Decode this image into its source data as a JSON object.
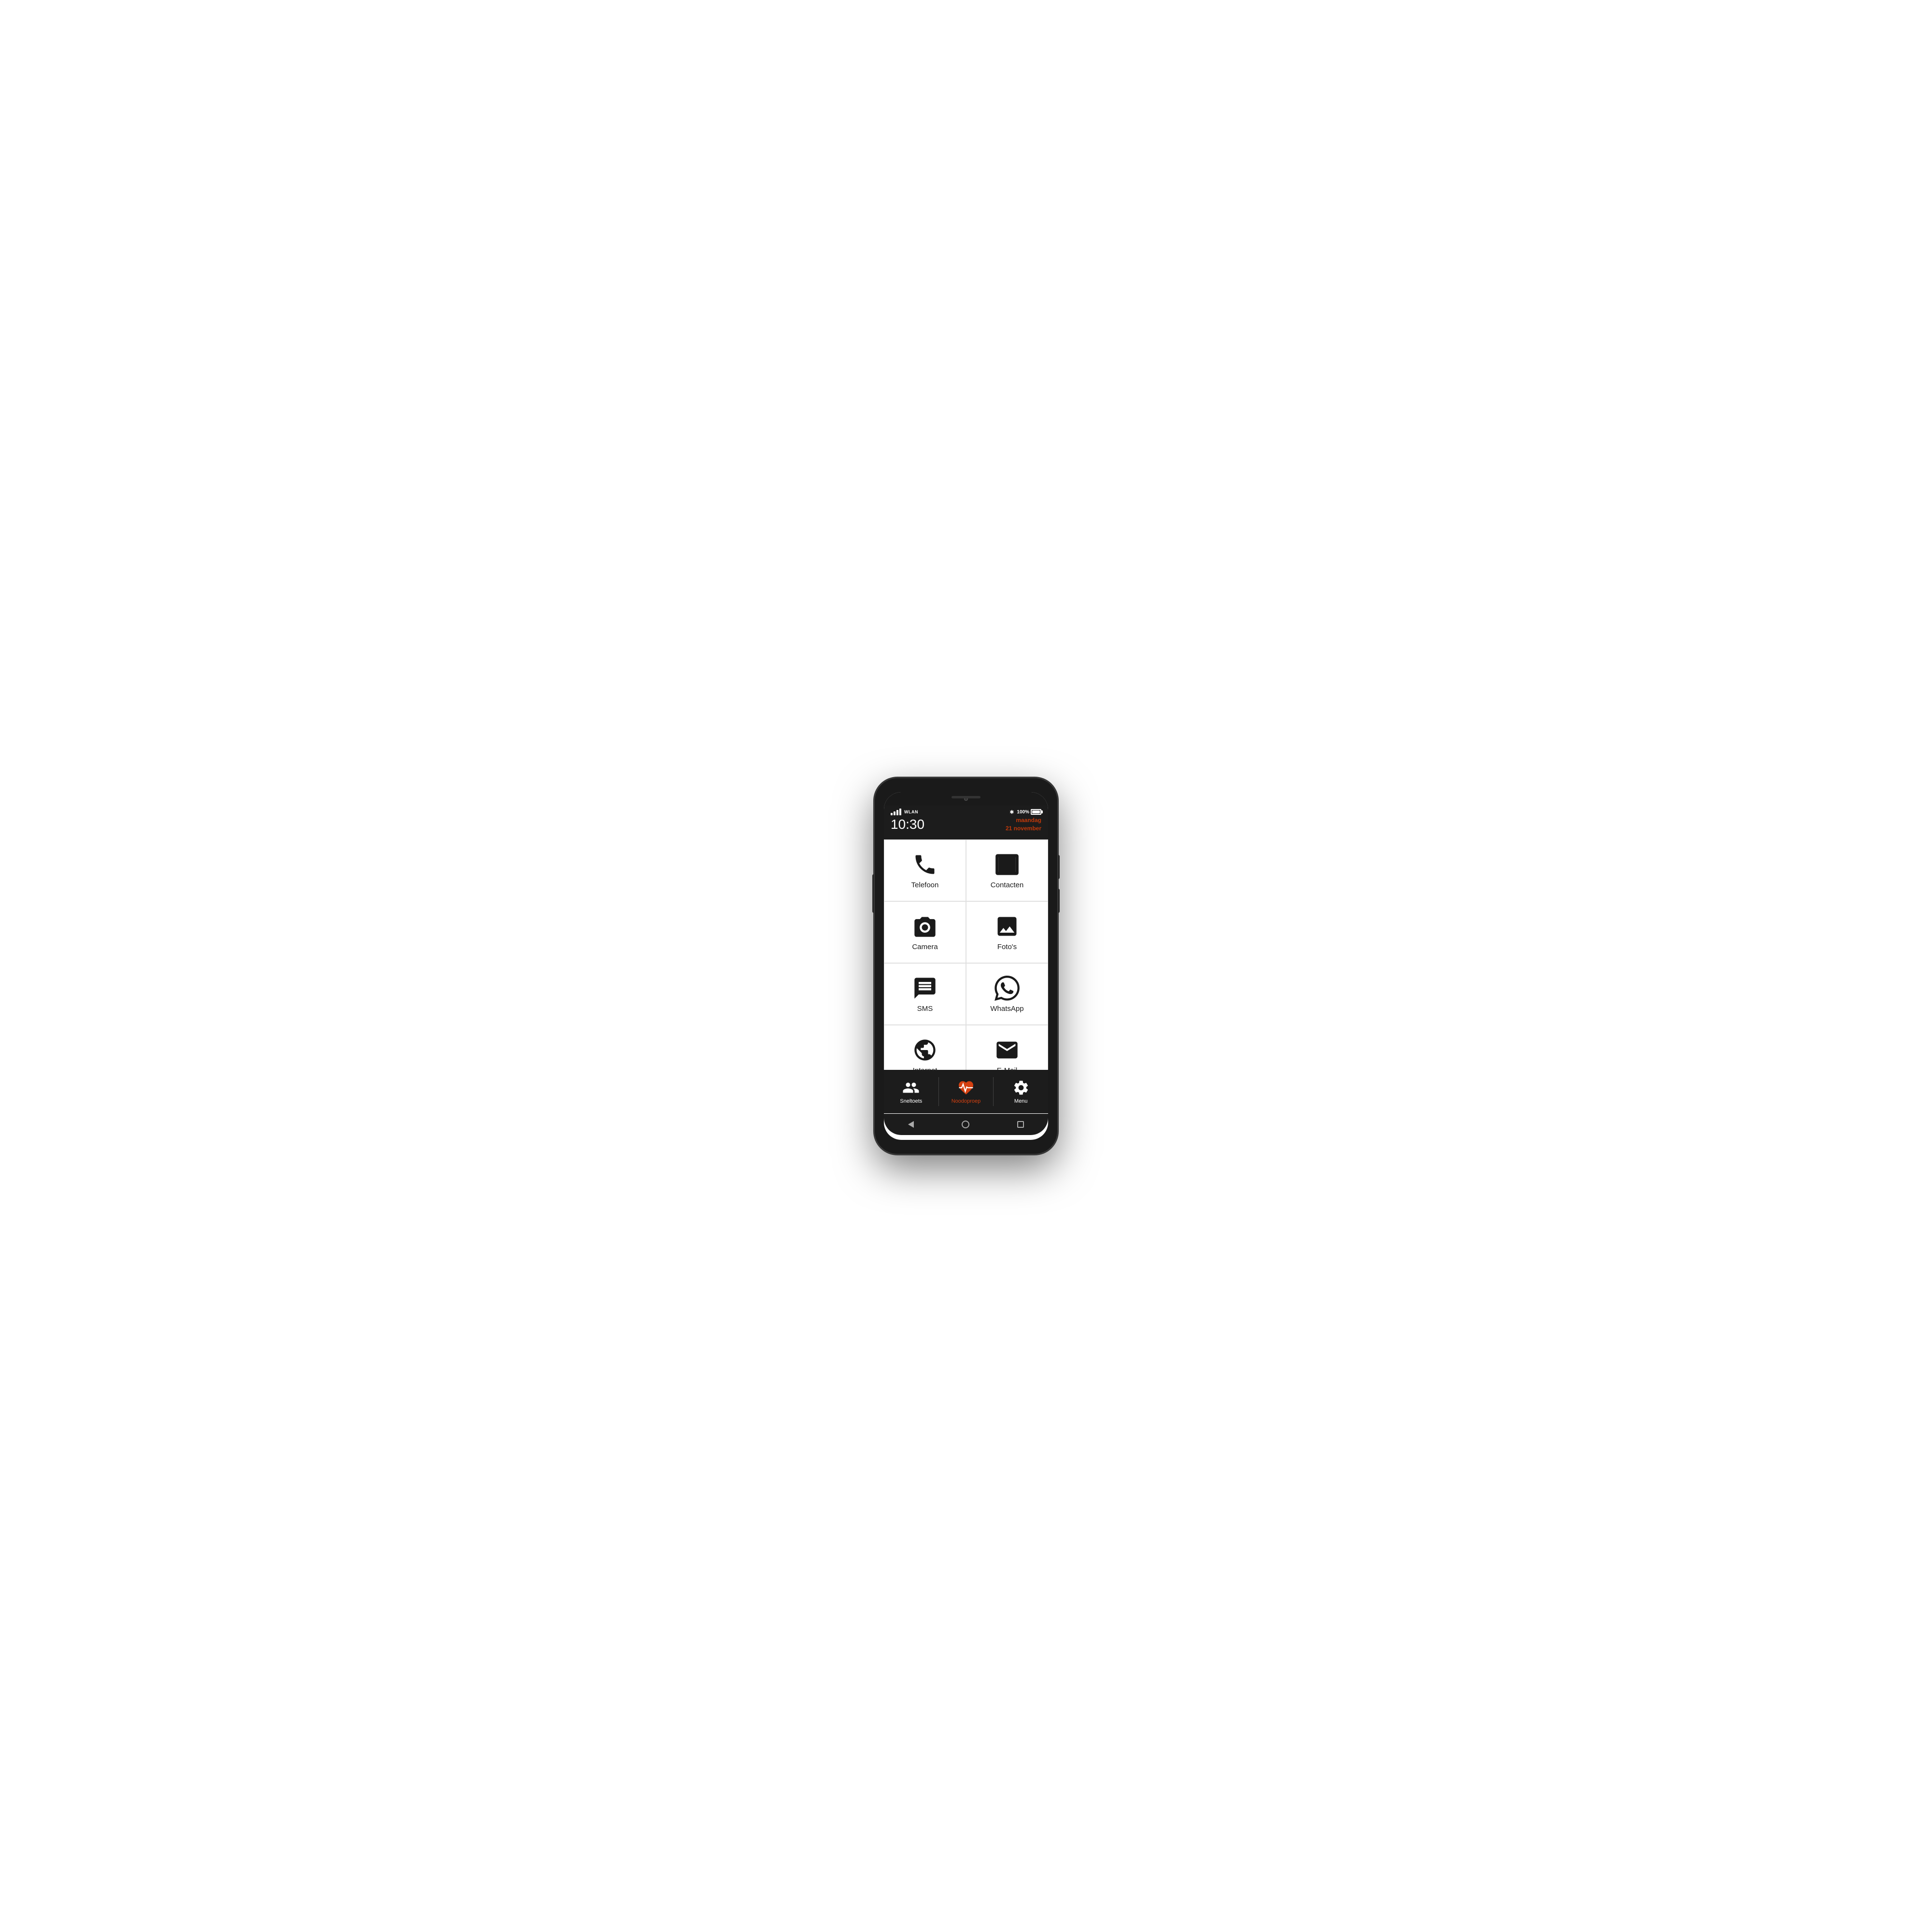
{
  "phone": {
    "status": {
      "wlan": "WLAN",
      "battery_percent": "100%",
      "time": "10:30",
      "day": "maandag",
      "date": "21 november"
    },
    "apps": [
      {
        "id": "telefoon",
        "label": "Telefoon",
        "icon": "phone"
      },
      {
        "id": "contacten",
        "label": "Contacten",
        "icon": "contacts"
      },
      {
        "id": "camera",
        "label": "Camera",
        "icon": "camera"
      },
      {
        "id": "fotos",
        "label": "Foto's",
        "icon": "photos"
      },
      {
        "id": "sms",
        "label": "SMS",
        "icon": "sms"
      },
      {
        "id": "whatsapp",
        "label": "WhatsApp",
        "icon": "whatsapp"
      },
      {
        "id": "internet",
        "label": "Internet",
        "icon": "internet"
      },
      {
        "id": "email",
        "label": "E-Mail",
        "icon": "email"
      }
    ],
    "bottom_nav": [
      {
        "id": "sneltoets",
        "label": "Sneltoets",
        "icon": "people",
        "active": false
      },
      {
        "id": "noodoproep",
        "label": "Noodoproep",
        "icon": "heart",
        "active": true
      },
      {
        "id": "menu",
        "label": "Menu",
        "icon": "gear",
        "active": false
      }
    ]
  }
}
